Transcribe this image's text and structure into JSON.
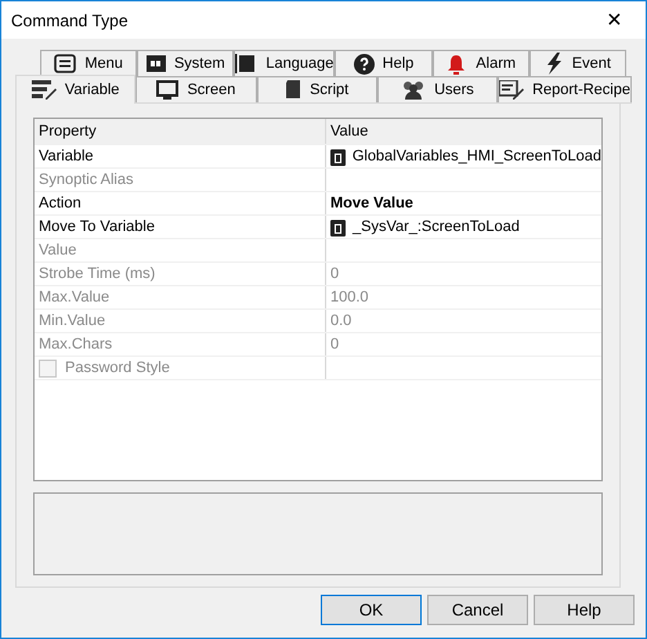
{
  "window": {
    "title": "Command Type",
    "close": "✕"
  },
  "tab_rows": [
    {
      "tabs": [
        {
          "label": "Menu",
          "selected": false
        },
        {
          "label": "System",
          "selected": false
        },
        {
          "label": "Language",
          "selected": false
        },
        {
          "label": "Help",
          "selected": false
        },
        {
          "label": "Alarm",
          "selected": false
        },
        {
          "label": "Event",
          "selected": false
        }
      ]
    },
    {
      "tabs": [
        {
          "label": "Variable",
          "selected": true
        },
        {
          "label": "Screen",
          "selected": false
        },
        {
          "label": "Script",
          "selected": false
        },
        {
          "label": "Users",
          "selected": false
        },
        {
          "label": "Report-Recipe",
          "selected": false
        }
      ]
    }
  ],
  "grid": {
    "columns": [
      "Property",
      "Value"
    ],
    "rows": [
      {
        "kind": "text",
        "property": "Variable",
        "disabled": false,
        "value": {
          "kind": "variable",
          "text": "GlobalVariables_HMI_ScreenToLoad"
        }
      },
      {
        "kind": "text",
        "property": "Synoptic Alias",
        "disabled": true
      },
      {
        "kind": "text",
        "property": "Action",
        "disabled": false,
        "value": {
          "kind": "bold",
          "text": "Move Value"
        }
      },
      {
        "kind": "text",
        "property": "Move To Variable",
        "disabled": false,
        "value": {
          "kind": "variable",
          "text": "_SysVar_:ScreenToLoad"
        }
      },
      {
        "kind": "text",
        "property": "Value",
        "disabled": true
      },
      {
        "kind": "text",
        "property": "Strobe Time (ms)",
        "disabled": true,
        "value": {
          "kind": "plain",
          "text": "0"
        }
      },
      {
        "kind": "text",
        "property": "Max.Value",
        "disabled": true,
        "value": {
          "kind": "plain",
          "text": "100.0"
        }
      },
      {
        "kind": "text",
        "property": "Min.Value",
        "disabled": true,
        "value": {
          "kind": "plain",
          "text": "0.0"
        }
      },
      {
        "kind": "text",
        "property": "Max.Chars",
        "disabled": true,
        "value": {
          "kind": "plain",
          "text": "0"
        }
      },
      {
        "kind": "checkbox",
        "property": "Password Style",
        "disabled": true,
        "checked": false
      }
    ]
  },
  "buttons": [
    "OK",
    "Cancel",
    "Help"
  ]
}
